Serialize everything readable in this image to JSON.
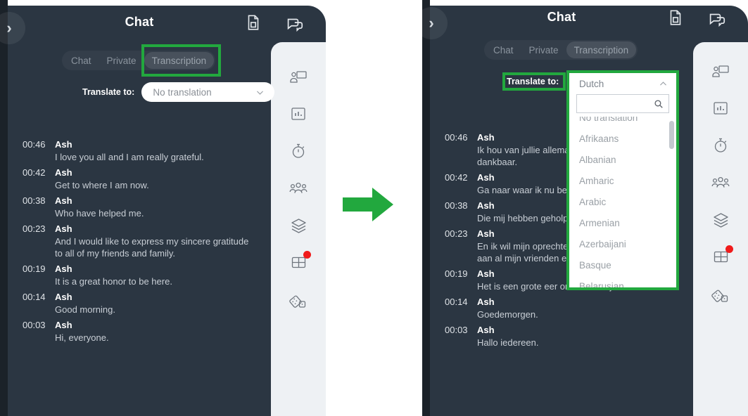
{
  "meta": {
    "accent_green": "#22a83e",
    "panel_dark": "#2b3642",
    "rail_bg": "#eef1f4",
    "badge_red": "#f01b1b"
  },
  "left_panel": {
    "collapse_label": "›",
    "header": {
      "title": "Chat",
      "doc_icon": "document-icon",
      "chat_icon": "chat-bubble-icon"
    },
    "tabs": [
      {
        "label": "Chat",
        "active": false
      },
      {
        "label": "Private",
        "active": false
      },
      {
        "label": "Transcription",
        "active": true
      }
    ],
    "translate": {
      "label": "Translate to:",
      "value": "No translation",
      "caret_icon": "chevron-down-icon"
    },
    "transcript": [
      {
        "time": "00:46",
        "name": "Ash",
        "text": "I love you all and I am really grateful."
      },
      {
        "time": "00:42",
        "name": "Ash",
        "text": "Get to where I am now."
      },
      {
        "time": "00:38",
        "name": "Ash",
        "text": "Who have helped me."
      },
      {
        "time": "00:23",
        "name": "Ash",
        "text": "And I would like to express my sincere gratitude to all of my friends and family."
      },
      {
        "time": "00:19",
        "name": "Ash",
        "text": "It is a great honor to be here."
      },
      {
        "time": "00:14",
        "name": "Ash",
        "text": "Good morning."
      },
      {
        "time": "00:03",
        "name": "Ash",
        "text": "Hi, everyone."
      }
    ],
    "rail_icons": [
      {
        "name": "screen-share-icon",
        "badge": false
      },
      {
        "name": "poll-chart-icon",
        "badge": false
      },
      {
        "name": "timer-icon",
        "badge": false
      },
      {
        "name": "participants-icon",
        "badge": false
      },
      {
        "name": "layers-icon",
        "badge": false
      },
      {
        "name": "layout-grid-icon",
        "badge": true
      },
      {
        "name": "dice-icon",
        "badge": false
      }
    ]
  },
  "right_panel": {
    "collapse_label": "›",
    "header": {
      "title": "Chat",
      "doc_icon": "document-icon",
      "chat_icon": "chat-bubble-icon"
    },
    "tabs": [
      {
        "label": "Chat",
        "active": false
      },
      {
        "label": "Private",
        "active": false
      },
      {
        "label": "Transcription",
        "active": true
      }
    ],
    "translate": {
      "label": "Translate to:",
      "value": "Dutch",
      "caret_icon": "chevron-up-icon",
      "search_placeholder": "",
      "search_value": "",
      "search_icon": "search-icon"
    },
    "dropdown_options": [
      "No translation",
      "Afrikaans",
      "Albanian",
      "Amharic",
      "Arabic",
      "Armenian",
      "Azerbaijani",
      "Basque",
      "Belarusian"
    ],
    "transcript": [
      {
        "time": "00:46",
        "name": "Ash",
        "text": "Ik hou van jullie allemaal en ik ben echt dankbaar."
      },
      {
        "time": "00:42",
        "name": "Ash",
        "text": "Ga naar waar ik nu ben."
      },
      {
        "time": "00:38",
        "name": "Ash",
        "text": "Die mij hebben geholpen."
      },
      {
        "time": "00:23",
        "name": "Ash",
        "text": "En ik wil mijn oprechte dankbaarheid uitspreken aan al mijn vrienden en familie."
      },
      {
        "time": "00:19",
        "name": "Ash",
        "text": "Het is een grote eer om hier te zijn."
      },
      {
        "time": "00:14",
        "name": "Ash",
        "text": "Goedemorgen."
      },
      {
        "time": "00:03",
        "name": "Ash",
        "text": "Hallo iedereen."
      }
    ],
    "rail_icons": [
      {
        "name": "screen-share-icon",
        "badge": false
      },
      {
        "name": "poll-chart-icon",
        "badge": false
      },
      {
        "name": "timer-icon",
        "badge": false
      },
      {
        "name": "participants-icon",
        "badge": false
      },
      {
        "name": "layers-icon",
        "badge": false
      },
      {
        "name": "layout-grid-icon",
        "badge": true
      },
      {
        "name": "dice-icon",
        "badge": false
      }
    ]
  },
  "flow_arrow": {
    "name": "right-arrow-icon"
  }
}
